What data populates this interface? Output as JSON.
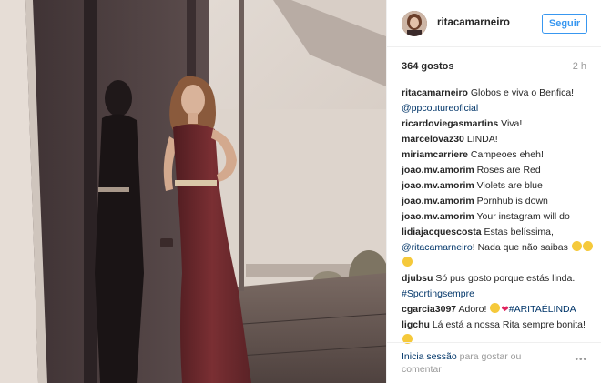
{
  "post": {
    "username": "ritacamarneiro",
    "follow_label": "Seguir",
    "likes": "364 gostos",
    "time_ago": "2 h"
  },
  "comments": [
    {
      "user": "ritacamarneiro",
      "text": "Globos e viva o Benfica!",
      "mention": "@ppcoutureoficial"
    },
    {
      "user": "ricardoviegasmartins",
      "text": "Viva!"
    },
    {
      "user": "marcelovaz30",
      "text": "LINDA!"
    },
    {
      "user": "miriamcarriere",
      "text": "Campeoes eheh!"
    },
    {
      "user": "joao.mv.amorim",
      "text": "Roses are Red"
    },
    {
      "user": "joao.mv.amorim",
      "text": "Violets are blue"
    },
    {
      "user": "joao.mv.amorim",
      "text": "Pornhub is down"
    },
    {
      "user": "joao.mv.amorim",
      "text": "Your instagram will do"
    },
    {
      "user": "lidiajacquescosta",
      "text": "Estas belíssima,",
      "mention": "@ritacamarneiro",
      "text2": "! Nada que não saibas"
    },
    {
      "user": "djubsu",
      "text": "Só pus gosto porque estás linda.",
      "hashtag": "#Sportingsempre"
    },
    {
      "user": "cgarcia3097",
      "text": "Adoro!",
      "hashtag": "#ARITAÉLINDA"
    },
    {
      "user": "ligchu",
      "text": "Lá está a nossa Rita sempre bonita!"
    }
  ],
  "footer": {
    "login_link": "Inicia sessão",
    "login_suffix": " para gostar ou comentar",
    "more_label": "•••"
  },
  "icons": {
    "avatar": "profile-avatar",
    "more": "more-options-icon"
  },
  "colors": {
    "link": "#3897f0",
    "mention": "#003569",
    "text": "#262626",
    "muted": "#999999",
    "dress": "#6e2a2d"
  }
}
